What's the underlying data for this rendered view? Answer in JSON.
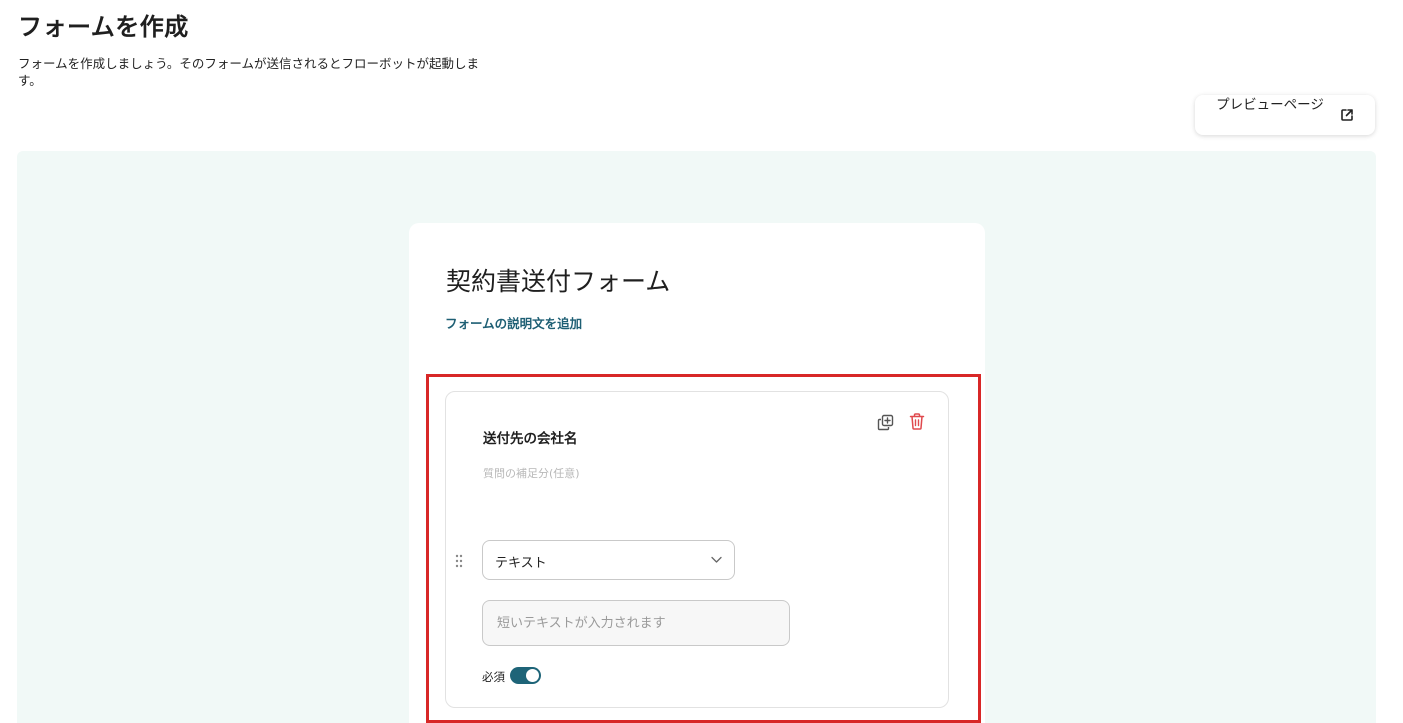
{
  "header": {
    "title": "フォームを作成",
    "description": "フォームを作成しましょう。そのフォームが送信されるとフローボットが起動します。"
  },
  "toolbar": {
    "preview_label": "プレビューページ",
    "preview_icon": "external-link-icon"
  },
  "form": {
    "title": "契約書送付フォーム",
    "add_description_link": "フォームの説明文を追加"
  },
  "question": {
    "title": "送付先の会社名",
    "hint_placeholder": "質問の補足分(任意)",
    "type_selected": "テキスト",
    "answer_placeholder": "短いテキストが入力されます",
    "required_label": "必須",
    "required_on": true,
    "icons": [
      "drag-handle-icon",
      "copy-icon",
      "trash-icon",
      "chevron-down-icon"
    ]
  },
  "colors": {
    "accent": "#1e6478",
    "link": "#1e5f74",
    "danger": "#e0494d",
    "highlight": "#d82727",
    "canvas_bg": "#f1f9f7"
  }
}
